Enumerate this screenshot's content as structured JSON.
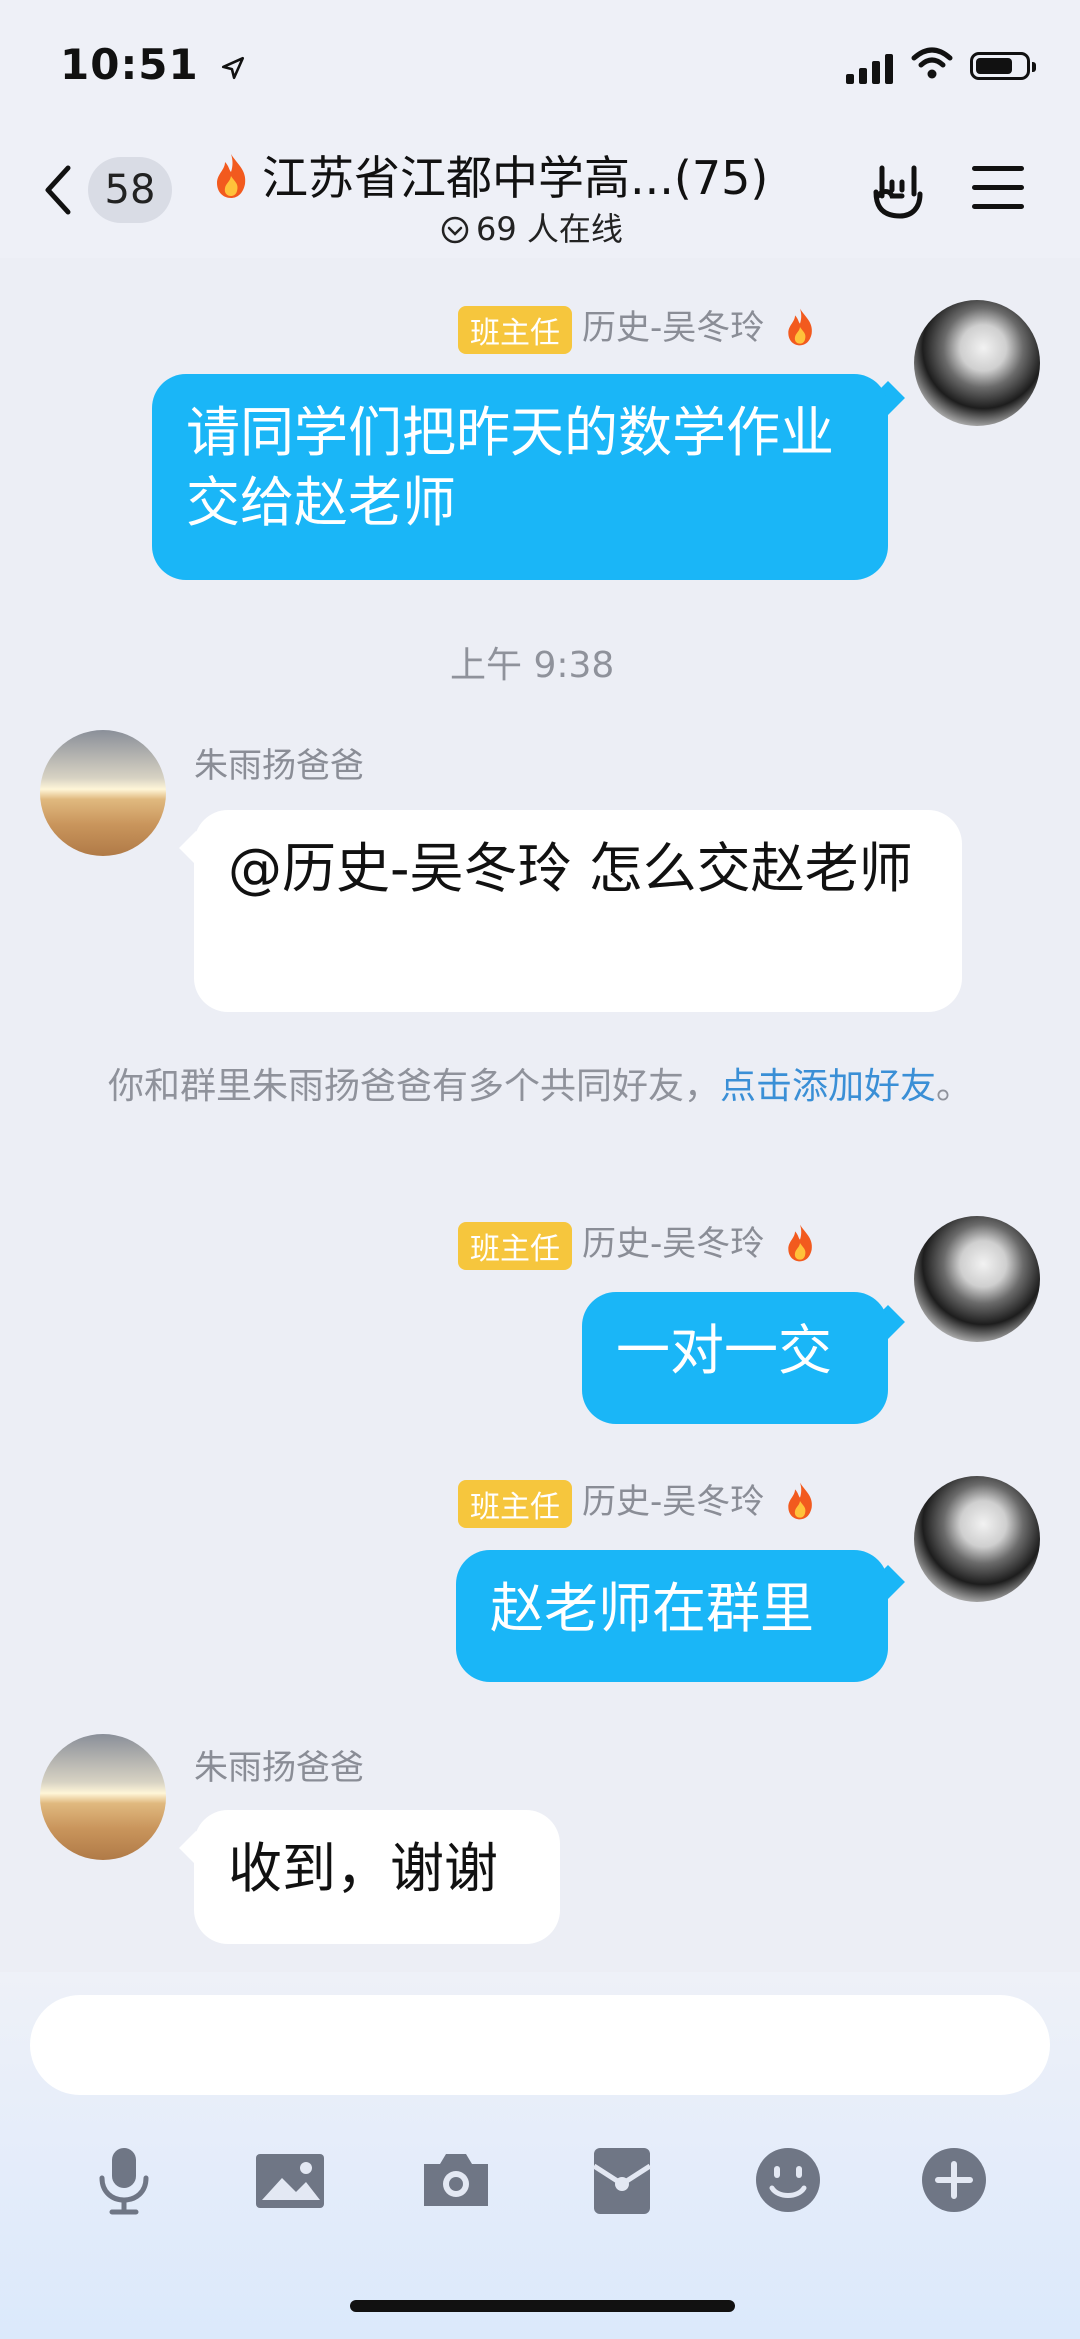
{
  "status_bar": {
    "time": "10:51",
    "location_icon": "location-arrow-icon",
    "battery_level": 0.75
  },
  "header": {
    "back_count": "58",
    "title": "江苏省江都中学高...(75)",
    "title_icon": "fire-icon",
    "online": "69 人在线"
  },
  "messages": [
    {
      "side": "right",
      "badge": "班主任",
      "sender": "历史-吴冬玲",
      "text": "请同学们把昨天的数学作业交给赵老师"
    },
    {
      "type": "time",
      "text": "上午 9:38"
    },
    {
      "side": "left",
      "sender": "朱雨扬爸爸",
      "text": "@历史-吴冬玲 怎么交赵老师"
    },
    {
      "type": "system",
      "text": "你和群里朱雨扬爸爸有多个共同好友，",
      "link": "点击添加好友",
      "suffix": "。"
    },
    {
      "side": "right",
      "badge": "班主任",
      "sender": "历史-吴冬玲",
      "text": "一对一交"
    },
    {
      "side": "right",
      "badge": "班主任",
      "sender": "历史-吴冬玲",
      "text": "赵老师在群里"
    },
    {
      "side": "left",
      "sender": "朱雨扬爸爸",
      "text": "收到，谢谢"
    }
  ],
  "toolbar": {
    "icons": [
      "microphone-icon",
      "image-icon",
      "camera-icon",
      "red-packet-icon",
      "emoji-icon",
      "plus-icon"
    ]
  },
  "colors": {
    "bubble_blue": "#1ab6f7",
    "badge_yellow": "#f6c63d",
    "link_blue": "#3a8fd6"
  }
}
